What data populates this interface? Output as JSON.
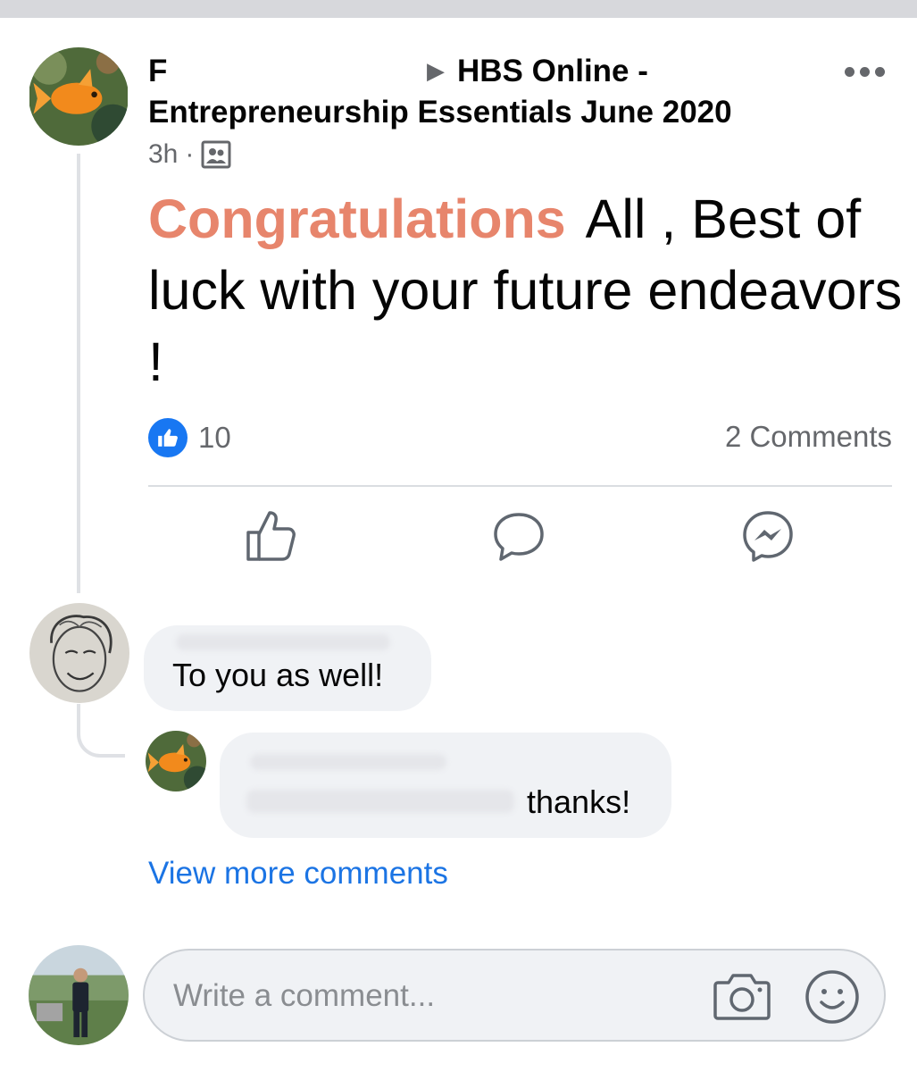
{
  "post": {
    "author": "F",
    "group": "HBS Online - Entrepreneurship Essentials June 2020",
    "time": "3h",
    "separator": "·",
    "text_highlight": "Congratulations",
    "text_rest": "All , Best of luck with your future endeavors !",
    "like_count": "10",
    "comments_count": "2 Comments",
    "audience_icon": "group-icon"
  },
  "comments": [
    {
      "text": "To you as well!"
    },
    {
      "text": "thanks!"
    }
  ],
  "view_more": "View more comments",
  "composer": {
    "placeholder": "Write a comment..."
  },
  "colors": {
    "highlight": "#e7856c",
    "link": "#1b74e4",
    "like": "#1877f2",
    "muted": "#65676b"
  }
}
